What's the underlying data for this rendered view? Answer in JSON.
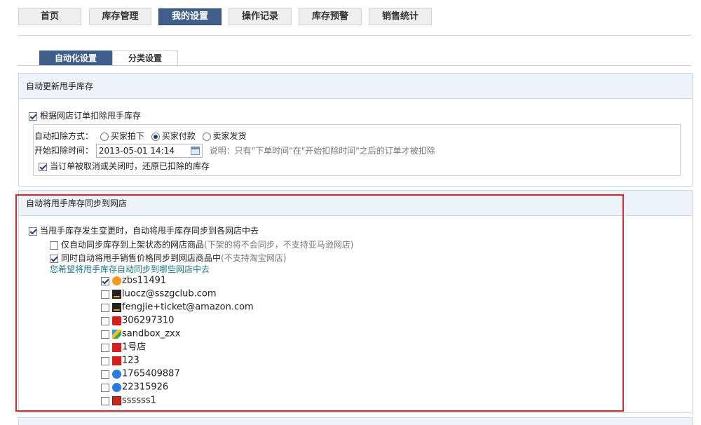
{
  "nav": {
    "items": [
      {
        "label": "首页",
        "active": false
      },
      {
        "label": "库存管理",
        "active": false
      },
      {
        "label": "我的设置",
        "active": true
      },
      {
        "label": "操作记录",
        "active": false
      },
      {
        "label": "库存预警",
        "active": false
      },
      {
        "label": "销售统计",
        "active": false
      }
    ]
  },
  "subtabs": [
    {
      "label": "自动化设置",
      "active": true
    },
    {
      "label": "分类设置",
      "active": false
    }
  ],
  "section1": {
    "title": "自动更新甩手库存",
    "deduct_by_order": {
      "label": "根据网店订单扣除甩手库存",
      "checked": true
    },
    "mode_label": "自动扣除方式：",
    "modes": [
      {
        "label": "买家拍下",
        "checked": false
      },
      {
        "label": "买家付款",
        "checked": true
      },
      {
        "label": "卖家发货",
        "checked": false
      }
    ],
    "start_time_label": "开始扣除时间：",
    "start_time_value": "2013-05-01 14:14",
    "note": "说明：只有\"下单时间\"在\"开始扣除时间\"之后的订单才被扣除",
    "restore": {
      "label": "当订单被取消或关闭时，还原已扣除的库存",
      "checked": true
    }
  },
  "section2": {
    "title": "自动将甩手库存同步到网店",
    "sync_main": {
      "label": "当甩手库存发生变更时，自动将甩手库存同步到各网店中去",
      "checked": true
    },
    "only_onsale": {
      "label": "仅自动同步库存到上架状态的网店商品",
      "note": "(下架的将不会同步，不支持亚马逊网店)",
      "checked": false
    },
    "sync_price": {
      "label": "同时自动将甩手销售价格同步到网店商品中",
      "note": "(不支持淘宝网店)",
      "checked": true
    },
    "prompt": "您希望将甩手库存自动同步到哪些网店中去",
    "shops": [
      {
        "name": "zbs11491",
        "icon": "taobao-icon",
        "checked": true
      },
      {
        "name": "luocz@sszgclub.com",
        "icon": "amazon-icon",
        "checked": false
      },
      {
        "name": "fengjie+ticket@amazon.com",
        "icon": "amazon-icon",
        "checked": false
      },
      {
        "name": "306297310",
        "icon": "red-shop-icon",
        "checked": false
      },
      {
        "name": "sandbox_zxx",
        "icon": "stripe-shop-icon",
        "checked": false
      },
      {
        "name": "1号店",
        "icon": "yhd-icon",
        "checked": false
      },
      {
        "name": "123",
        "icon": "yhd-icon",
        "checked": false
      },
      {
        "name": "1765409887",
        "icon": "paipai-icon",
        "checked": false
      },
      {
        "name": "22315926",
        "icon": "paipai-icon",
        "checked": false
      },
      {
        "name": "ssssss1",
        "icon": "dian-icon",
        "checked": false
      }
    ]
  },
  "colors": {
    "nav_active": "#3f5e8a",
    "section_header": "#edf3f9",
    "highlight_frame": "#d22b2b"
  }
}
